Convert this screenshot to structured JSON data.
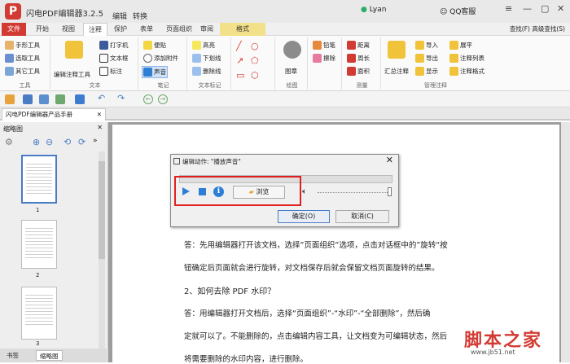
{
  "titlebar": {
    "app_title": "闪电PDF编辑器3.2.5",
    "context_tabs": [
      "编辑",
      "转换"
    ],
    "user": "Lyan",
    "support": "QQ客服",
    "logo_letter": "P"
  },
  "menu": {
    "tabs": [
      "文件",
      "开始",
      "视图",
      "注释",
      "保护",
      "表单",
      "页面组织",
      "审阅",
      "格式"
    ],
    "active": "注释",
    "help_find": "查找(F)",
    "help_advanced": "高级查找(S)"
  },
  "ribbon": {
    "tools": {
      "items": [
        "手形工具",
        "选取工具",
        "其它工具"
      ],
      "label": "工具"
    },
    "text": {
      "large": "编辑注释工具",
      "items": [
        "打字机",
        "文本框",
        "标注"
      ],
      "label": "文本"
    },
    "notes": {
      "items": [
        "便贴",
        "添加附件",
        "声音"
      ],
      "label": "笔记"
    },
    "markup": {
      "items": [
        "高亮",
        "下划线",
        "删除线"
      ],
      "label": "文本标记"
    },
    "drawing": {
      "stamp": "图章",
      "label": "绘图"
    },
    "pencil": {
      "items": [
        "铅笔",
        "擦除"
      ]
    },
    "measure": {
      "items": [
        "距离",
        "周长",
        "面积"
      ],
      "label": "测量"
    },
    "manage": {
      "large": "汇总注释",
      "items": [
        "导入",
        "导出",
        "显示"
      ],
      "items2": [
        "展平",
        "注释列表",
        "注释格式"
      ],
      "label": "管理注释"
    }
  },
  "document_tab": "闪电PDF编辑器产品手册",
  "sidebar": {
    "title": "缩略图",
    "pages": [
      "1",
      "2",
      "3"
    ],
    "tabs": [
      "书签",
      "缩略图"
    ]
  },
  "page_text": {
    "lines": [
      "答：先用编辑器打开该文档，选择”页面组织”选项，点击对话框中的”旋转“按",
      "钮确定后页面就会进行旋转，对文档保存后就会保留文档页面旋转的结果。",
      "答：用编辑器打开文档后，选择“页面组织”-“水印”-“全部删除”，然后确",
      "定就可以了。不能删除的，点击编辑内容工具，让文档变为可编辑状态，然后",
      "将需要删除的水印内容，进行删除。"
    ],
    "heading": "2、如何去除 PDF 水印？"
  },
  "dialog": {
    "title": "编辑动作: \"播放声音\"",
    "browse": "浏览",
    "ok": "确定(O)",
    "cancel": "取消(C)",
    "close": "✕"
  },
  "watermark": {
    "text": "脚本之家",
    "url": "www.jb51.net"
  },
  "colors": {
    "brand": "#d23b33",
    "format_tab": "#f3e08a",
    "highlight": "#e02020",
    "media_blue": "#2d7fd6"
  }
}
